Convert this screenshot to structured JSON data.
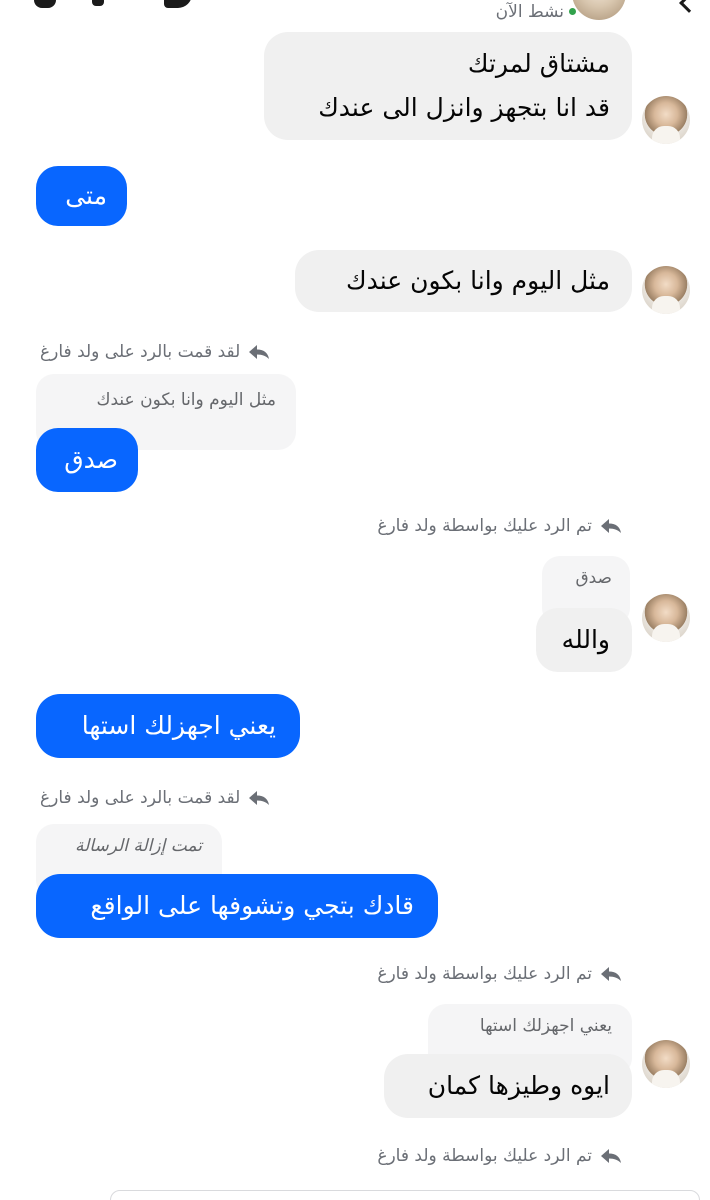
{
  "header": {
    "status": "نشط الآن"
  },
  "messages": {
    "m1_line1": "مشتاق لمرتك",
    "m1_line2": "قد انا بتجهز وانزل الى عندك",
    "m2": "متى",
    "m3": "مثل اليوم وانا بكون عندك",
    "m4_reply_label": "لقد قمت بالرد على ولد فارغ",
    "m4_quote": "مثل اليوم وانا بكون عندك",
    "m4": "صدق",
    "m5_reply_label": "تم الرد عليك بواسطة ولد فارغ",
    "m5_quote": "صدق",
    "m5": "والله",
    "m6": "يعني اجهزلك استها",
    "m7_reply_label": "لقد قمت بالرد على ولد فارغ",
    "m7_quote": "تمت إزالة الرسالة",
    "m7": "قادك بتجي وتشوفها على الواقع",
    "m8_reply_label": "تم الرد عليك بواسطة ولد فارغ",
    "m8_quote": "يعني اجهزلك استها",
    "m8": "ايوه وطيزها كمان",
    "m9_reply_label": "تم الرد عليك بواسطة ولد فارغ"
  },
  "colors": {
    "sent_bubble": "#0866ff",
    "received_bubble": "#f0f0f0",
    "online_dot": "#31a24c"
  },
  "icons": {
    "reply": "reply-arrow-icon",
    "online": "online-status-dot",
    "back": "back-arrow-icon"
  }
}
